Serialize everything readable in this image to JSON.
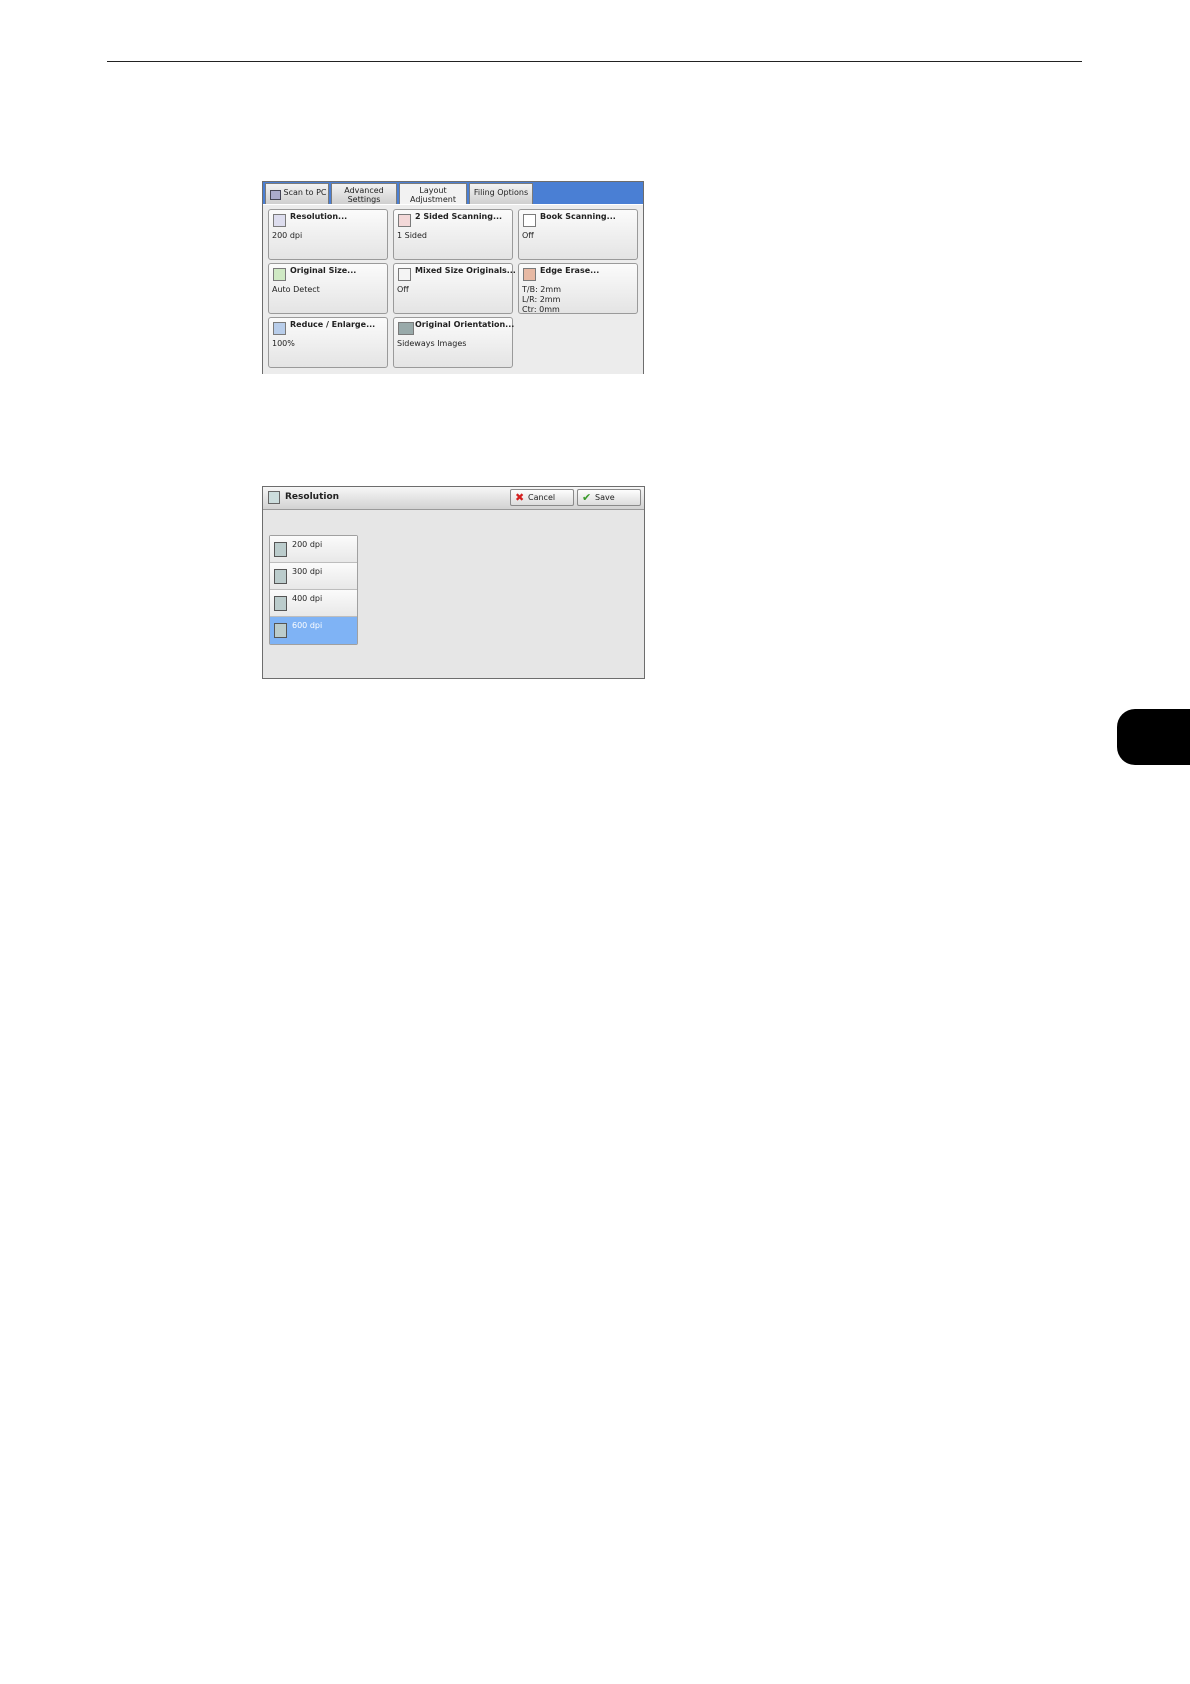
{
  "screen1": {
    "tabs": [
      {
        "label": "Scan to PC"
      },
      {
        "label": "Advanced Settings"
      },
      {
        "label": "Layout Adjustment"
      },
      {
        "label": "Filing Options"
      }
    ],
    "buttons": [
      {
        "title": "Resolution...",
        "value": "200 dpi",
        "icon": "resolution-icon"
      },
      {
        "title": "2 Sided Scanning...",
        "value": "1 Sided",
        "icon": "two-sided-icon"
      },
      {
        "title": "Book Scanning...",
        "value": "Off",
        "icon": "book-icon"
      },
      {
        "title": "Original Size...",
        "value": "Auto Detect",
        "icon": "original-size-icon"
      },
      {
        "title": "Mixed Size Originals...",
        "value": "Off",
        "icon": "mixed-size-icon"
      },
      {
        "title": "Edge Erase...",
        "value_lines": [
          "T/B: 2mm",
          "L/R: 2mm",
          "Ctr: 0mm"
        ],
        "icon": "edge-erase-icon"
      },
      {
        "title": "Reduce / Enlarge...",
        "value": "100%",
        "icon": "reduce-enlarge-icon"
      },
      {
        "title": "Original Orientation...",
        "value": "Sideways Images",
        "icon": "orientation-icon"
      }
    ]
  },
  "screen2": {
    "title": "Resolution",
    "cancel_label": "Cancel",
    "save_label": "Save",
    "options": [
      {
        "label": "200 dpi"
      },
      {
        "label": "300 dpi"
      },
      {
        "label": "400 dpi"
      },
      {
        "label": "600 dpi"
      }
    ],
    "selected": "600 dpi"
  },
  "colors": {
    "tab_bar_blue": "#4a7fd4",
    "selected_item": "#7fb3f5",
    "cancel_red": "#d42020",
    "save_green": "#3a9a2a"
  }
}
